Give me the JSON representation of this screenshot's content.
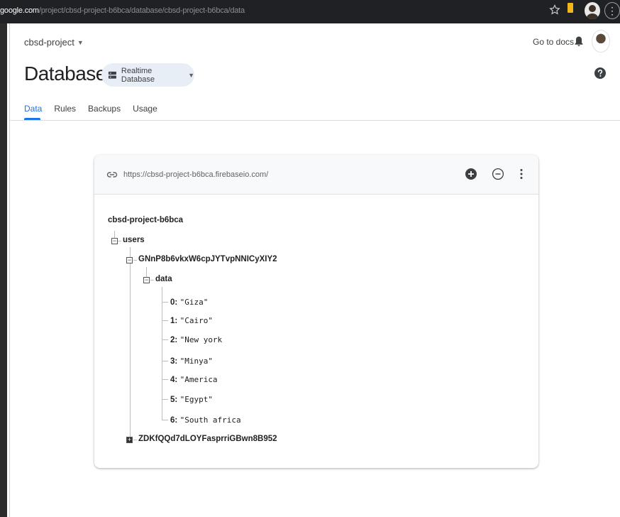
{
  "browser": {
    "url_host": "google.com",
    "url_path": "/project/cbsd-project-b6bca/database/cbsd-project-b6bca/data"
  },
  "header": {
    "project_name": "cbsd-project",
    "go_to_docs": "Go to docs",
    "page_title": "Database",
    "db_selector": "Realtime Database"
  },
  "tabs": [
    {
      "label": "Data",
      "active": true
    },
    {
      "label": "Rules",
      "active": false
    },
    {
      "label": "Backups",
      "active": false
    },
    {
      "label": "Usage",
      "active": false
    }
  ],
  "card": {
    "url": "https://cbsd-project-b6bca.firebaseio.com/"
  },
  "tree": {
    "root": "cbsd-project-b6bca",
    "users": "users",
    "user1": "GNnP8b6vkxW6cpJYTvpNNICyXIY2",
    "data": "data",
    "items": [
      {
        "key": "0:",
        "value": "\"Giza\""
      },
      {
        "key": "1:",
        "value": "\"Cairo\""
      },
      {
        "key": "2:",
        "value": "\"New york"
      },
      {
        "key": "3:",
        "value": "\"Minya\""
      },
      {
        "key": "4:",
        "value": "\"America"
      },
      {
        "key": "5:",
        "value": "\"Egypt\""
      },
      {
        "key": "6:",
        "value": "\"South africa"
      }
    ],
    "user2": "ZDKfQQd7dLOYFasprriGBwn8B952"
  },
  "colors": {
    "accent": "#1a73e8",
    "chrome": "#202124"
  }
}
